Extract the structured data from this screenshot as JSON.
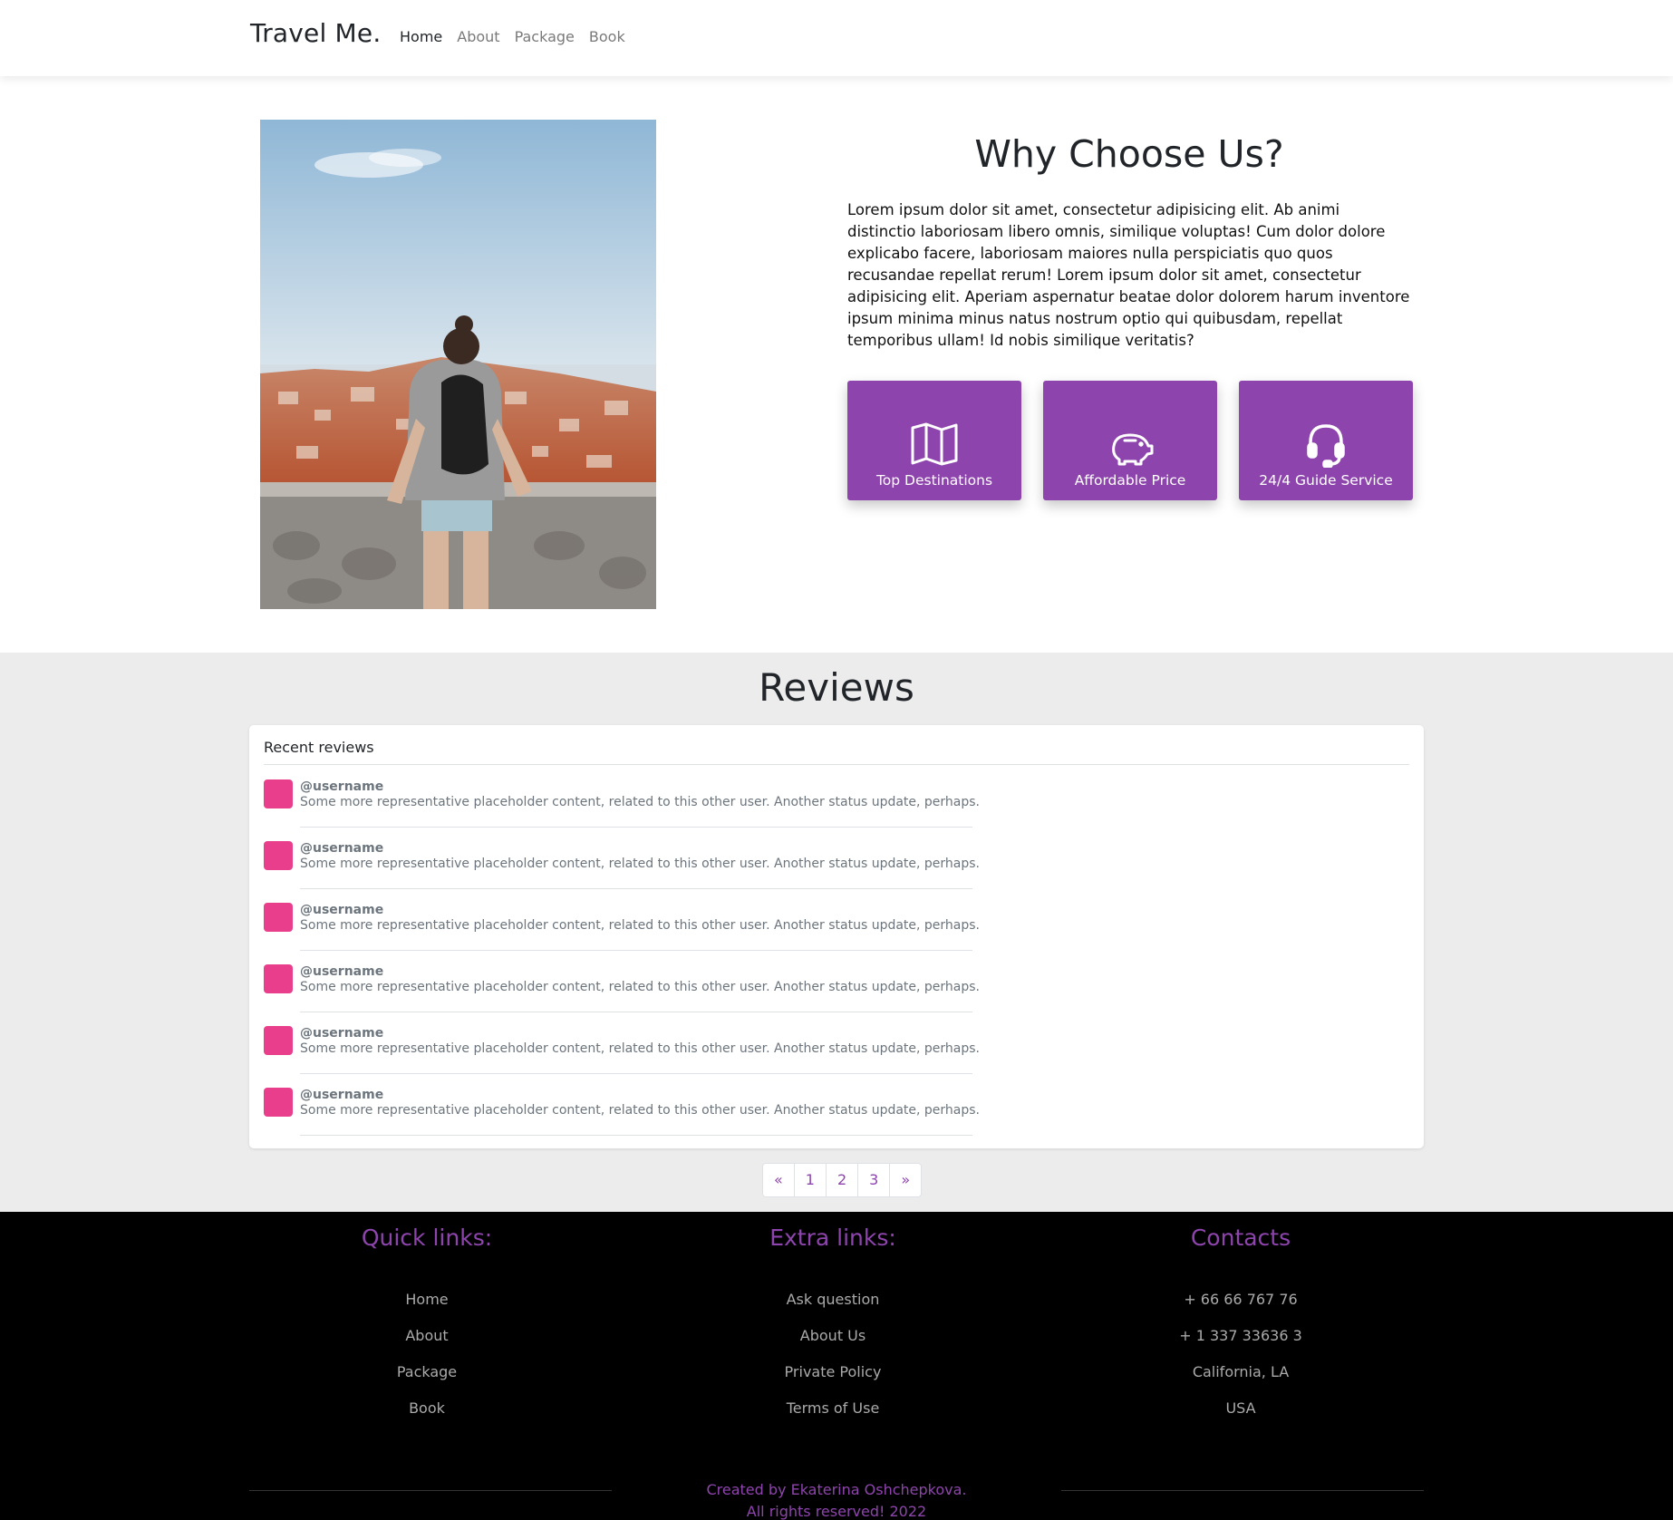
{
  "navbar": {
    "brand": "Travel Me.",
    "links": [
      "Home",
      "About",
      "Package",
      "Book"
    ]
  },
  "why": {
    "title": "Why Choose Us?",
    "text": "Lorem ipsum dolor sit amet, consectetur adipisicing elit. Ab animi distinctio laboriosam libero omnis, similique voluptas! Cum dolor dolore explicabo facere, laboriosam maiores nulla perspiciatis quo quos recusandae repellat rerum! Lorem ipsum dolor sit amet, consectetur adipisicing elit. Aperiam aspernatur beatae dolor dolorem harum inventore ipsum minima minus natus nostrum optio qui quibusdam, repellat temporibus ullam! Id nobis similique veritatis?",
    "features": [
      {
        "label": "Top Destinations",
        "icon": "map-icon"
      },
      {
        "label": "Affordable Price",
        "icon": "piggy-bank-icon"
      },
      {
        "label": "24/4 Guide Service",
        "icon": "headset-icon"
      }
    ]
  },
  "reviews": {
    "title": "Reviews",
    "card_title": "Recent reviews",
    "items": [
      {
        "user": "@username",
        "text": "Some more representative placeholder content, related to this other user. Another status update, perhaps."
      },
      {
        "user": "@username",
        "text": "Some more representative placeholder content, related to this other user. Another status update, perhaps."
      },
      {
        "user": "@username",
        "text": "Some more representative placeholder content, related to this other user. Another status update, perhaps."
      },
      {
        "user": "@username",
        "text": "Some more representative placeholder content, related to this other user. Another status update, perhaps."
      },
      {
        "user": "@username",
        "text": "Some more representative placeholder content, related to this other user. Another status update, perhaps."
      },
      {
        "user": "@username",
        "text": "Some more representative placeholder content, related to this other user. Another status update, perhaps."
      }
    ],
    "pagination": [
      "«",
      "1",
      "2",
      "3",
      "»"
    ]
  },
  "footer": {
    "quick": {
      "title": "Quick links:",
      "links": [
        "Home",
        "About",
        "Package",
        "Book"
      ]
    },
    "extra": {
      "title": "Extra links:",
      "links": [
        "Ask question",
        "About Us",
        "Private Policy",
        "Terms of Use"
      ]
    },
    "contacts": {
      "title": "Contacts",
      "links": [
        "+ 66 66 767 76",
        "+ 1 337 33636 3",
        "California, LA",
        "USA"
      ]
    },
    "credit_line1": "Created by Ekaterina Oshchepkova.",
    "credit_line2": "All rights reserved! 2022"
  },
  "colors": {
    "accent": "#8e44ad",
    "avatar": "#e83e8c",
    "section_bg": "#ececec",
    "footer_bg": "#000000"
  }
}
